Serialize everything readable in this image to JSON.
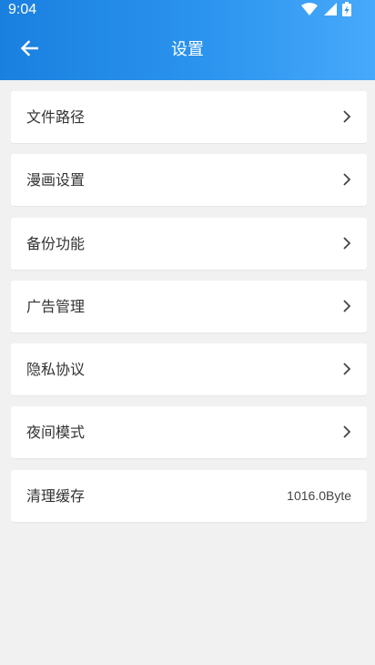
{
  "status_bar": {
    "time": "9:04",
    "icons": [
      "wifi-icon",
      "cellular-signal-icon",
      "battery-charging-icon"
    ]
  },
  "header": {
    "title": "设置",
    "back_icon": "arrow-left-icon"
  },
  "settings": {
    "items": [
      {
        "label": "文件路径",
        "icon": "chevron-right-icon"
      },
      {
        "label": "漫画设置",
        "icon": "chevron-right-icon"
      },
      {
        "label": "备份功能",
        "icon": "chevron-right-icon"
      },
      {
        "label": "广告管理",
        "icon": "chevron-right-icon"
      },
      {
        "label": "隐私协议",
        "icon": "chevron-right-icon"
      },
      {
        "label": "夜间模式",
        "icon": "chevron-right-icon"
      }
    ],
    "clear_cache": {
      "label": "清理缓存",
      "value": "1016.0Byte"
    }
  },
  "colors": {
    "header_gradient_start": "#1a80e0",
    "header_gradient_end": "#47a9fb",
    "background": "#f1f1f1",
    "row_background": "#ffffff",
    "text": "#333333"
  }
}
